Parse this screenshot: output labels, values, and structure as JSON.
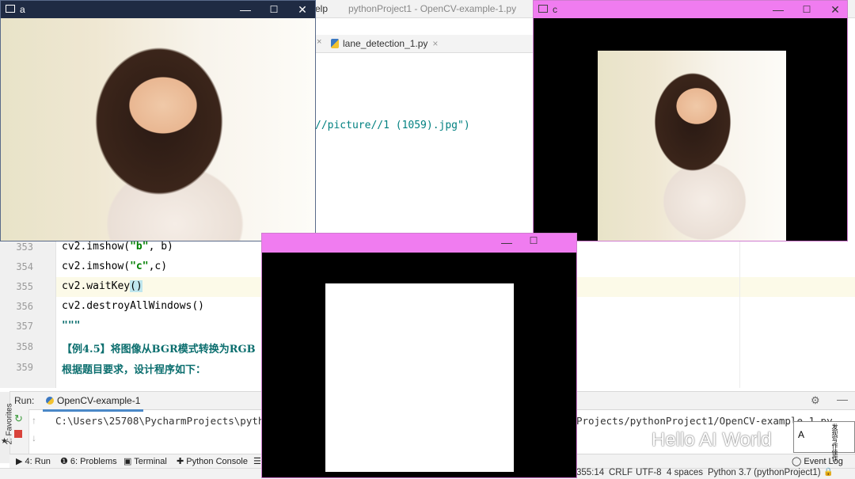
{
  "ide": {
    "menu_help": "elp",
    "title": "pythonProject1 - OpenCV-example-1.py",
    "tab_close": "×",
    "tab_file": "lane_detection_1.py",
    "tab_x": "×",
    "code_fragment": "//picture//1 (1059).jpg\")",
    "lines": [
      {
        "num": "353",
        "pre": "cv2.imshow(",
        "str": "\"b\"",
        "post": ", b)"
      },
      {
        "num": "354",
        "pre": "cv2.imshow(",
        "str": "\"c\"",
        "post": ",c)"
      },
      {
        "num": "355",
        "pre": "cv2.waitKey",
        "paren": "()",
        "post": ""
      },
      {
        "num": "356",
        "pre": "cv2.destroyAllWindows()",
        "post": ""
      },
      {
        "num": "357",
        "doc": "\"\"\""
      },
      {
        "num": "358",
        "doc": "【例4.5】将图像从BGR模式转换为RGB"
      },
      {
        "num": "359",
        "doc": "根据题目要求，设计程序如下："
      }
    ]
  },
  "run": {
    "label": "Run:",
    "tab": "OpenCV-example-1",
    "gear": "⚙",
    "minimize": "—",
    "rerun": "↻",
    "up": "↑",
    "down": "↓",
    "console_left": "C:\\Users\\25708\\PycharmProjects\\python",
    "console_right": "Projects/pythonProject1/OpenCV-example-1.py"
  },
  "sidebar": {
    "favorites": "2: Favorites",
    "star": "★"
  },
  "bottom_tabs": {
    "run": "▶ 4: Run",
    "problems": "❶ 6: Problems",
    "terminal": "▣ Terminal",
    "python_console": "✚ Python Console",
    "more": "☰",
    "event_log": "◯ Event Log"
  },
  "status": {
    "position": "355:14",
    "line_sep": "CRLF",
    "encoding": "UTF-8",
    "indent": "4 spaces",
    "interpreter": "Python 3.7 (pythonProject1)",
    "lock": "🔒"
  },
  "windows": {
    "a": {
      "title": "a",
      "minimize": "—",
      "maximize": "☐",
      "close": "✕"
    },
    "c": {
      "title": "c",
      "minimize": "—",
      "maximize": "☐",
      "close": "✕"
    },
    "b": {
      "minimize": "—",
      "maximize": "☐"
    }
  },
  "watermark": {
    "text": "Hello AI World",
    "seal_a": "A",
    "seal_b": "发现写作佳作"
  },
  "colors": {
    "window_title_dark": "#1f2b43",
    "window_title_magenta": "#f07cf0",
    "line_highlight": "#fcfae8"
  }
}
